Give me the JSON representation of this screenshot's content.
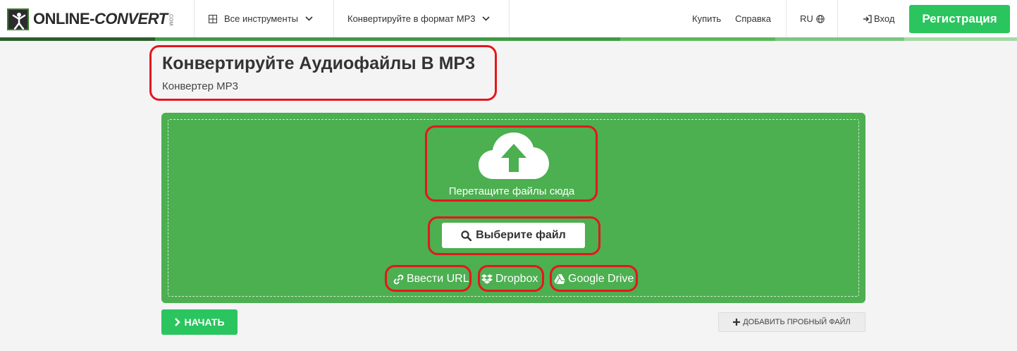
{
  "header": {
    "logo_text_1": "ONLINE",
    "logo_dash": "-",
    "logo_text_2": "CONVERT",
    "logo_com": ".COM",
    "all_tools": "Все инструменты",
    "convert_to": "Конвертируйте в формат MP3",
    "buy": "Купить",
    "help": "Справка",
    "language": "RU",
    "login": "Вход",
    "register": "Регистрация"
  },
  "page": {
    "title": "Конвертируйте Аудиофайлы В MP3",
    "subtitle": "Конвертер MP3"
  },
  "upload": {
    "drop_text": "Перетащите файлы сюда",
    "choose_file": "Выберите файл",
    "sources": [
      {
        "label": "Ввести URL",
        "icon": "link-icon"
      },
      {
        "label": "Dropbox",
        "icon": "dropbox-icon"
      },
      {
        "label": "Google Drive",
        "icon": "google-drive-icon"
      }
    ]
  },
  "actions": {
    "start": "НАЧАТЬ",
    "add_sample": "ДОБАВИТЬ ПРОБНЫЙ ФАЙЛ"
  },
  "colors": {
    "brand_green": "#2ac55e",
    "upload_green": "#4caf50",
    "annotation_red": "#e4171c"
  }
}
